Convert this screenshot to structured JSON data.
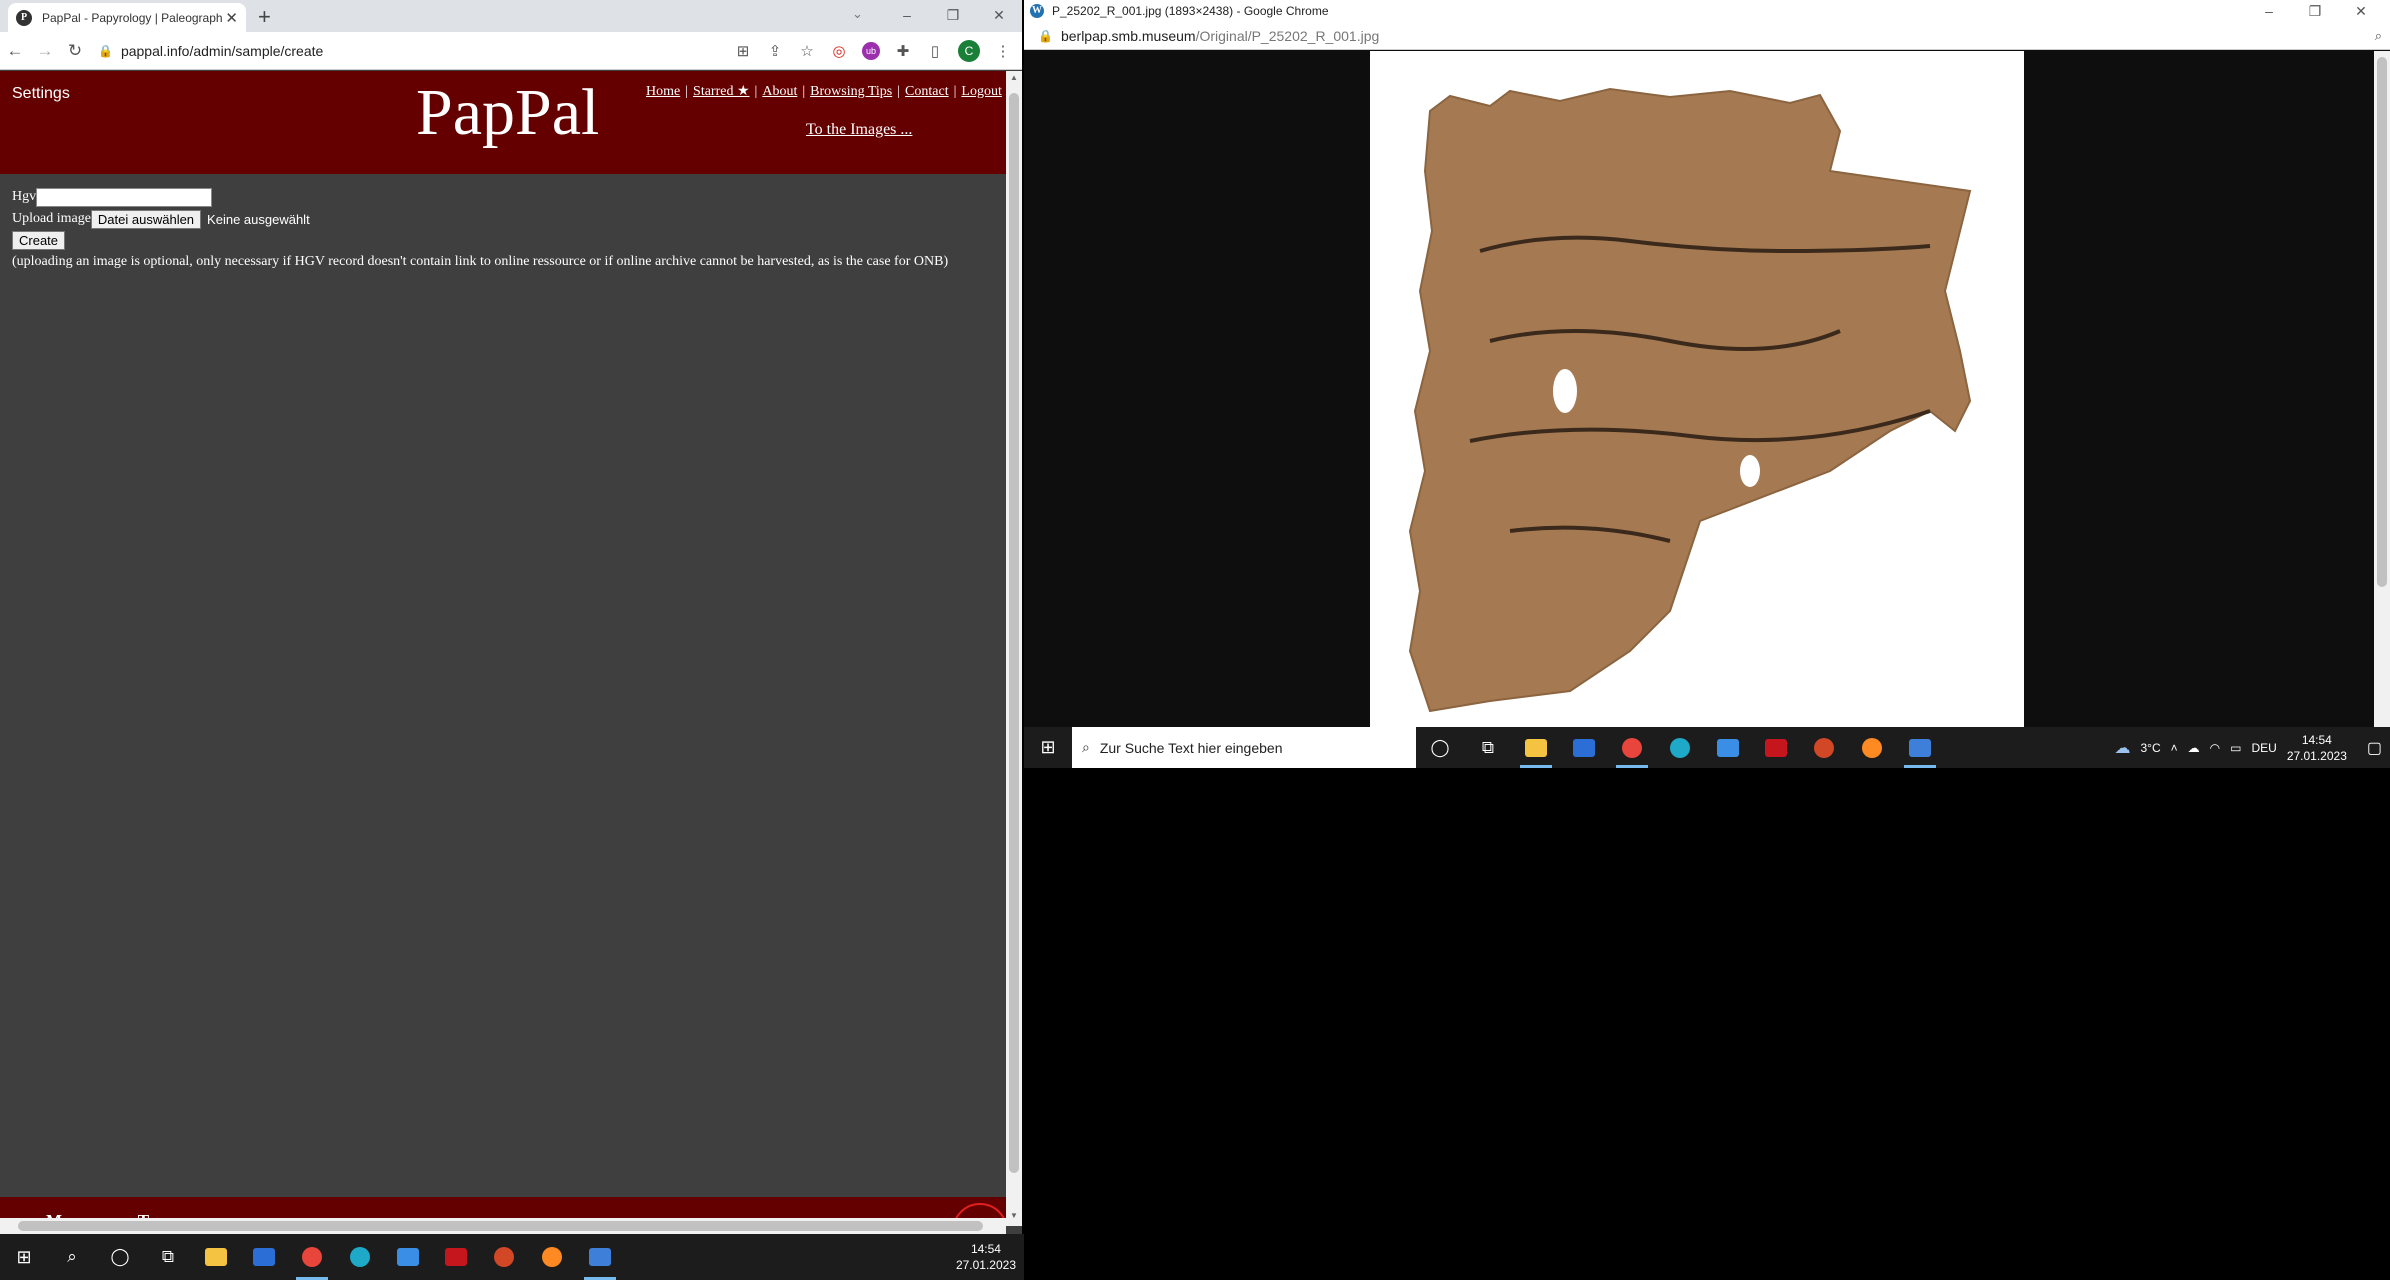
{
  "left": {
    "tab_title": "PapPal - Papyrology | Paleography",
    "favicon_letter": "P",
    "url": "pappal.info/admin/sample/create",
    "avatar_letter": "C",
    "page": {
      "settings": "Settings",
      "logo": "PapPal",
      "nav": [
        "Home",
        "Starred ★",
        "About",
        "Browsing Tips",
        "Contact",
        "Logout"
      ],
      "nav_sep": "|",
      "to_images": "To the Images ...",
      "hgv_label": "Hgv",
      "upload_label": "Upload image",
      "file_button": "Datei auswählen",
      "no_file": "Keine ausgewählt",
      "create_button": "Create",
      "note": "(uploading an image is optional, only necessary if HGV record doesn't contain link to online ressource or if online archive cannot be harvested, as is the case for ONB)",
      "footer_brand": "Materiale Textkulturen"
    }
  },
  "right": {
    "title": "P_25202_R_001.jpg (1893×2438) - Google Chrome",
    "url_host": "berlpap.smb.museum",
    "url_path": "/Original/P_25202_R_001.jpg"
  },
  "taskbar_small": {
    "time": "14:54",
    "date": "27.01.2023"
  },
  "taskbar_large": {
    "search_placeholder": "Zur Suche Text hier eingeben",
    "weather": "3°C",
    "lang": "DEU",
    "time": "14:54",
    "date": "27.01.2023"
  },
  "colors": {
    "header": "#640000",
    "page_bg": "#3f3f3f",
    "taskbar": "#1c1c1c"
  }
}
